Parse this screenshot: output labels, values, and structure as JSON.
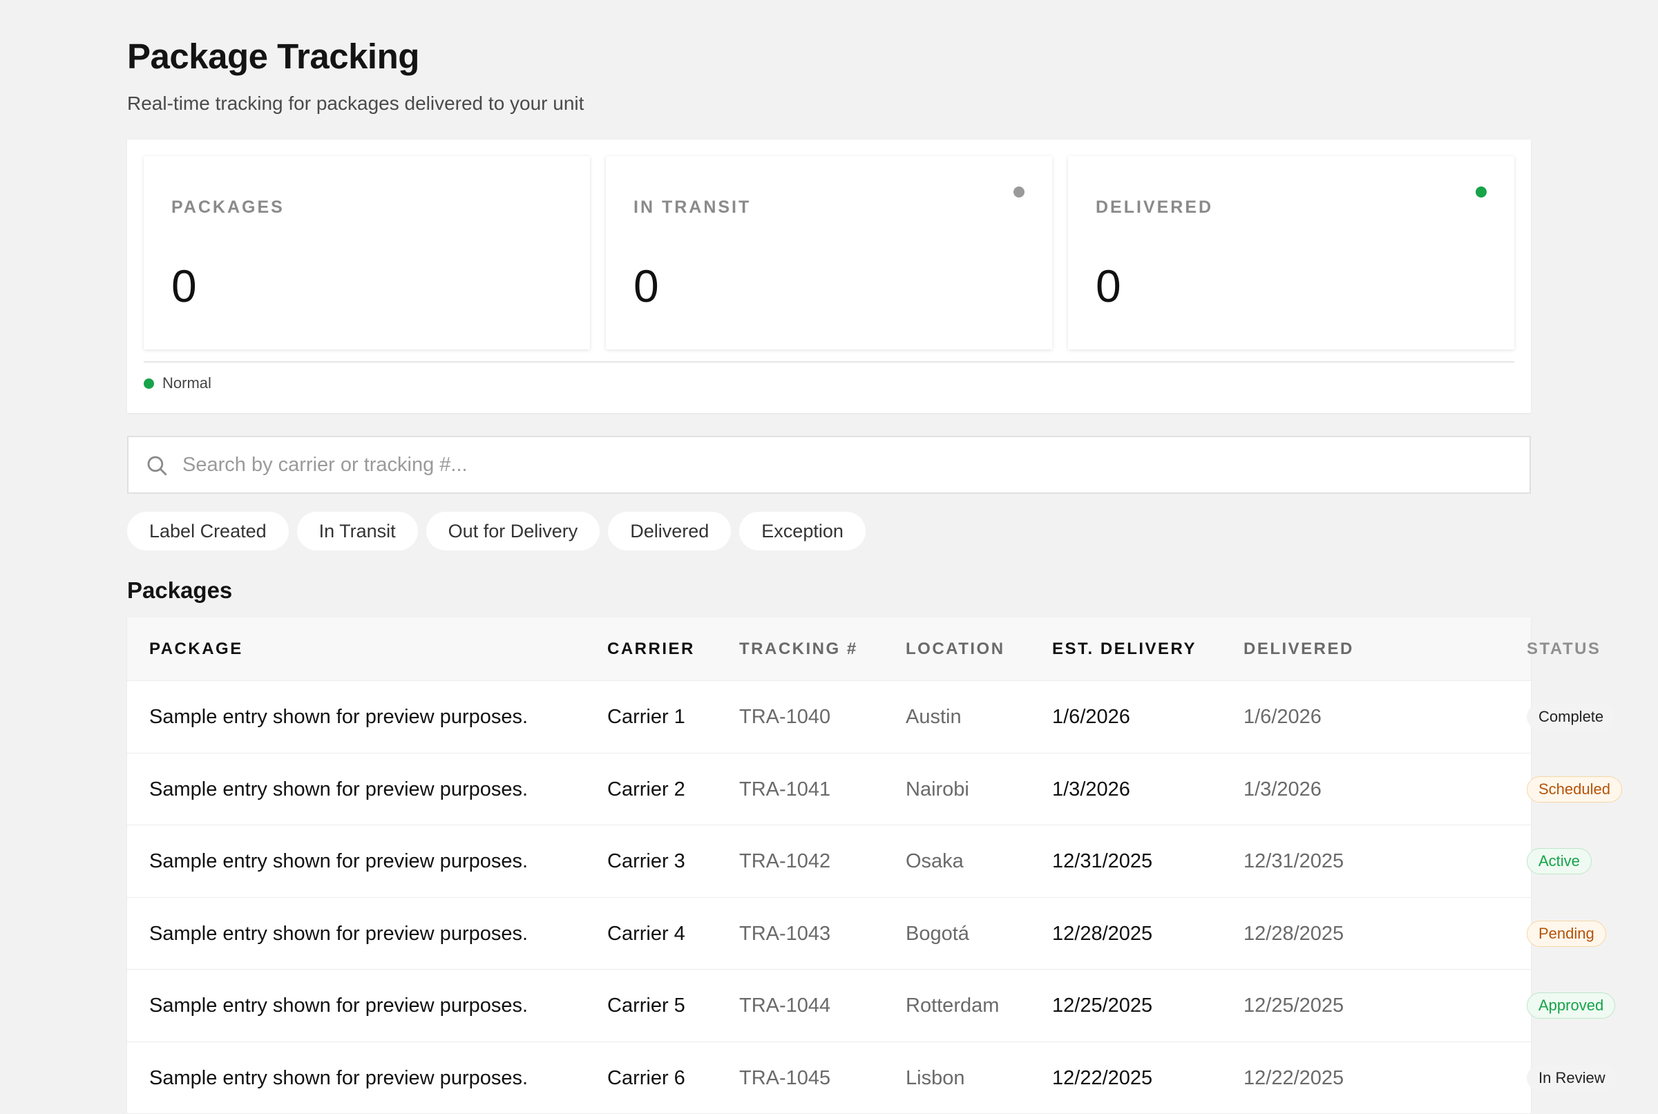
{
  "header": {
    "title": "Package Tracking",
    "subtitle": "Real-time tracking for packages delivered to your unit"
  },
  "stats": [
    {
      "label": "PACKAGES",
      "value": "0",
      "indicator": "none"
    },
    {
      "label": "IN TRANSIT",
      "value": "0",
      "indicator": "gray",
      "indicator_color": "#9a9a9a"
    },
    {
      "label": "DELIVERED",
      "value": "0",
      "indicator": "green",
      "indicator_color": "#16a34a"
    }
  ],
  "legend": {
    "label": "Normal",
    "color": "#16a34a"
  },
  "search": {
    "placeholder": "Search by carrier or tracking #...",
    "value": "",
    "icon": "search-icon"
  },
  "filters": [
    "Label Created",
    "In Transit",
    "Out for Delivery",
    "Delivered",
    "Exception"
  ],
  "section_title": "Packages",
  "table": {
    "columns": [
      "PACKAGE",
      "CARRIER",
      "TRACKING #",
      "LOCATION",
      "EST. DELIVERY",
      "DELIVERED",
      "STATUS"
    ],
    "rows": [
      {
        "package": "Sample entry shown for preview purposes.",
        "carrier": "Carrier 1",
        "tracking": "TRA-1040",
        "location": "Austin",
        "est_delivery": "1/6/2026",
        "delivered": "1/6/2026",
        "status": "Complete"
      },
      {
        "package": "Sample entry shown for preview purposes.",
        "carrier": "Carrier 2",
        "tracking": "TRA-1041",
        "location": "Nairobi",
        "est_delivery": "1/3/2026",
        "delivered": "1/3/2026",
        "status": "Scheduled"
      },
      {
        "package": "Sample entry shown for preview purposes.",
        "carrier": "Carrier 3",
        "tracking": "TRA-1042",
        "location": "Osaka",
        "est_delivery": "12/31/2025",
        "delivered": "12/31/2025",
        "status": "Active"
      },
      {
        "package": "Sample entry shown for preview purposes.",
        "carrier": "Carrier 4",
        "tracking": "TRA-1043",
        "location": "Bogotá",
        "est_delivery": "12/28/2025",
        "delivered": "12/28/2025",
        "status": "Pending"
      },
      {
        "package": "Sample entry shown for preview purposes.",
        "carrier": "Carrier 5",
        "tracking": "TRA-1044",
        "location": "Rotterdam",
        "est_delivery": "12/25/2025",
        "delivered": "12/25/2025",
        "status": "Approved"
      },
      {
        "package": "Sample entry shown for preview purposes.",
        "carrier": "Carrier 6",
        "tracking": "TRA-1045",
        "location": "Lisbon",
        "est_delivery": "12/22/2025",
        "delivered": "12/22/2025",
        "status": "In Review"
      }
    ]
  },
  "status_colors": {
    "Complete": {
      "bg": "#f3f3f3",
      "fg": "#222222",
      "border": "#f3f3f3"
    },
    "Scheduled": {
      "bg": "#fff7ec",
      "fg": "#b45309",
      "border": "#f5d7a8"
    },
    "Active": {
      "bg": "#effaf2",
      "fg": "#16a34a",
      "border": "#bfe6cb"
    },
    "Pending": {
      "bg": "#fff7ec",
      "fg": "#b45309",
      "border": "#f5d7a8"
    },
    "Approved": {
      "bg": "#effaf2",
      "fg": "#16a34a",
      "border": "#bfe6cb"
    },
    "In Review": {
      "bg": "#f3f3f3",
      "fg": "#222222",
      "border": "#f3f3f3"
    }
  }
}
